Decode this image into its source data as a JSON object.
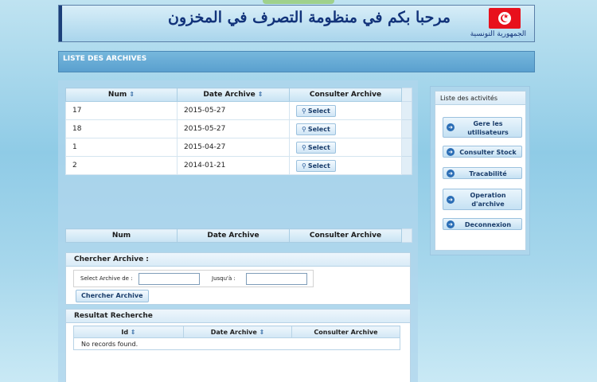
{
  "banner": {
    "arabic_title": "مرحبا بكم في منظومة التصرف في المخزون",
    "republic_label": "الجمهورية التونسية"
  },
  "page_title": "LISTE DES ARCHIVES",
  "archives_table": {
    "columns": [
      "Num",
      "Date Archive",
      "Consulter Archive"
    ],
    "rows": [
      {
        "num": "17",
        "date": "2015-05-27",
        "action": "Select"
      },
      {
        "num": "18",
        "date": "2015-05-27",
        "action": "Select"
      },
      {
        "num": "1",
        "date": "2015-04-27",
        "action": "Select"
      },
      {
        "num": "2",
        "date": "2014-01-21",
        "action": "Select"
      }
    ]
  },
  "second_table": {
    "columns": [
      "Num",
      "Date Archive",
      "Consulter Archive"
    ]
  },
  "search": {
    "heading": "Chercher Archive :",
    "from_label": "Select Archive de :",
    "to_label": "Jusqu'à :",
    "from_value": "",
    "to_value": "",
    "button_label": "Chercher Archive"
  },
  "results": {
    "heading": "Resultat Recherche",
    "columns": [
      "Id",
      "Date Archive",
      "Consulter Archive"
    ],
    "empty_message": "No records found."
  },
  "sidebar": {
    "heading": "Liste des activités",
    "items": [
      {
        "label": "Gere les utilisateurs"
      },
      {
        "label": "Consulter Stock"
      },
      {
        "label": "Tracabilité"
      },
      {
        "label": "Operation d'archive"
      },
      {
        "label": "Deconnexion"
      }
    ]
  },
  "colors": {
    "title_bar": "#5aa0cf",
    "banner_text": "#12337a",
    "flag_red": "#e8101c"
  }
}
